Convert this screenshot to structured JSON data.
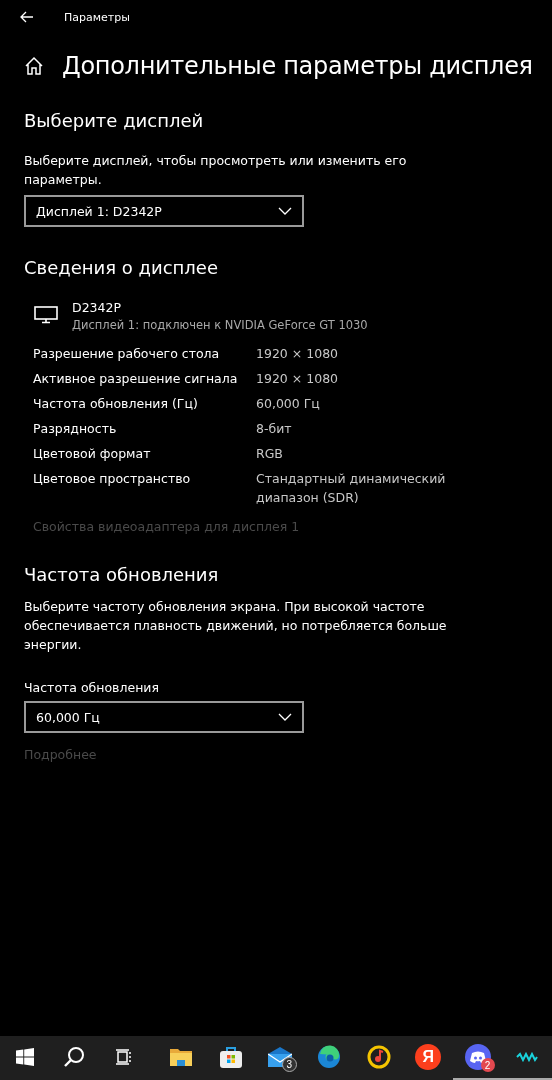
{
  "window": {
    "title": "Параметры"
  },
  "page_title": "Дополнительные параметры дисплея",
  "select_display": {
    "heading": "Выберите дисплей",
    "description": "Выберите дисплей, чтобы просмотреть или изменить его параметры.",
    "dropdown": {
      "value": "Дисплей 1: D2342P"
    }
  },
  "display_info": {
    "heading": "Сведения о дисплее",
    "monitor_name": "D2342P",
    "monitor_subtitle": "Дисплей 1: подключен к NVIDIA GeForce GT 1030",
    "rows": [
      {
        "label": "Разрешение рабочего стола",
        "value": "1920 × 1080"
      },
      {
        "label": "Активное разрешение сигнала",
        "value": "1920 × 1080"
      },
      {
        "label": "Частота обновления (Гц)",
        "value": "60,000 Гц"
      },
      {
        "label": "Разрядность",
        "value": "8-бит"
      },
      {
        "label": "Цветовой формат",
        "value": "RGB"
      },
      {
        "label": "Цветовое пространство",
        "value": "Стандартный динамический диапазон (SDR)"
      }
    ],
    "link": {
      "text": "Свойства видеоадаптера для дисплея 1",
      "disabled": true
    }
  },
  "refresh_rate": {
    "heading": "Частота обновления",
    "description": "Выберите частоту обновления экрана. При высокой частоте обеспечивается плавность движений, но потребляется больше энергии.",
    "field_label": "Частота обновления",
    "dropdown": {
      "value": "60,000 Гц"
    },
    "link": {
      "text": "Подробнее",
      "disabled": true
    }
  },
  "taskbar": [
    {
      "kind": "start",
      "running": false
    },
    {
      "kind": "search",
      "running": false
    },
    {
      "kind": "taskview",
      "running": false
    },
    {
      "kind": "folder",
      "running": false
    },
    {
      "kind": "store",
      "running": false
    },
    {
      "kind": "mail",
      "badge": "3",
      "running": false
    },
    {
      "kind": "edge",
      "running": false
    },
    {
      "kind": "music",
      "running": false
    },
    {
      "kind": "letter",
      "label": "Я",
      "running": false
    },
    {
      "kind": "discord",
      "badge": "2",
      "running": true
    },
    {
      "kind": "wave",
      "running": true
    }
  ]
}
